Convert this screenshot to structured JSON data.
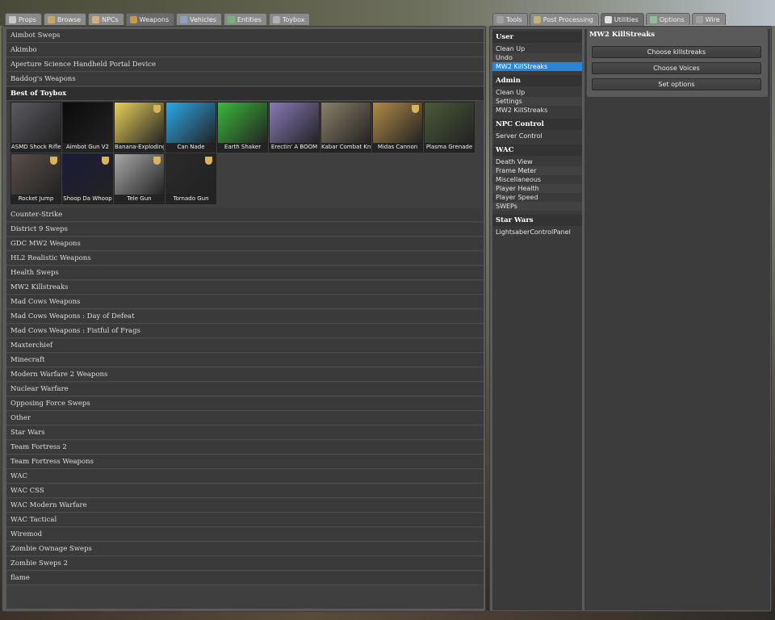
{
  "left_tabs": [
    {
      "label": "Props",
      "icon": "grid-icon",
      "color": "#c8c8c8",
      "active": false
    },
    {
      "label": "Browse",
      "icon": "folder-icon",
      "color": "#c9a75a",
      "active": false
    },
    {
      "label": "NPCs",
      "icon": "npc-icon",
      "color": "#d0b080",
      "active": false
    },
    {
      "label": "Weapons",
      "icon": "bomb-icon",
      "color": "#c89a40",
      "active": true
    },
    {
      "label": "Vehicles",
      "icon": "car-icon",
      "color": "#8aa0c8",
      "active": false
    },
    {
      "label": "Entities",
      "icon": "entity-icon",
      "color": "#7ab07a",
      "active": false
    },
    {
      "label": "Toybox",
      "icon": "toybox-icon",
      "color": "#b0b0b0",
      "active": false
    }
  ],
  "right_tabs": [
    {
      "label": "Tools",
      "icon": "wrench-icon",
      "color": "#a0a0a0",
      "active": false
    },
    {
      "label": "Post Processing",
      "icon": "camera-icon",
      "color": "#c8b070",
      "active": false
    },
    {
      "label": "Utilities",
      "icon": "page-icon",
      "color": "#e0e0e0",
      "active": true
    },
    {
      "label": "Options",
      "icon": "options-icon",
      "color": "#90c090",
      "active": false
    },
    {
      "label": "Wire",
      "icon": "wire-icon",
      "color": "#a0a0a0",
      "active": false
    }
  ],
  "categories_top": [
    "Aimbot Sweps",
    "Akimbo",
    "Aperture Science Handheld Portal Device",
    "Baddog's Weapons"
  ],
  "expanded_category": "Best of Toybox",
  "weapons": [
    {
      "label": "ASMD Shock Rifle",
      "color": "#5a5a62",
      "shield": false
    },
    {
      "label": "Aimbot Gun V2",
      "color": "#0a0a0a",
      "shield": false
    },
    {
      "label": "Banana-Exploding-...",
      "color": "#e8d05a",
      "shield": true
    },
    {
      "label": "Can Nade",
      "color": "#2aa8e8",
      "shield": false
    },
    {
      "label": "Earth Shaker",
      "color": "#3ab83a",
      "shield": false
    },
    {
      "label": "Erectin' A BOOM",
      "color": "#8a7ab8",
      "shield": false
    },
    {
      "label": "Kabar Combat Knife",
      "color": "#8a8068",
      "shield": false
    },
    {
      "label": "Midas Cannon",
      "color": "#b08a48",
      "shield": true
    },
    {
      "label": "Plasma Grenade",
      "color": "#4a5a3a",
      "shield": false
    },
    {
      "label": "Rocket Jump",
      "color": "#5a5048",
      "shield": true
    },
    {
      "label": "Shoop Da Whoop",
      "color": "#1a1a3a",
      "shield": true
    },
    {
      "label": "Tele Gun",
      "color": "#a8a8a8",
      "shield": true
    },
    {
      "label": "Tornado Gun",
      "color": "#2a2a2a",
      "shield": true
    }
  ],
  "categories_bottom": [
    "Counter-Strike",
    "District 9 Sweps",
    "GDC MW2 Weapons",
    "HL2 Realistic Weapons",
    "Health Sweps",
    "MW2 Killstreaks",
    "Mad Cows Weapons",
    "Mad Cows Weapons : Day of Defeat",
    "Mad Cows Weapons : Fistful of Frags",
    "Maxterchief",
    "Minecraft",
    "Modern Warfare 2 Weapons",
    "Nuclear Warfare",
    "Opposing Force Sweps",
    "Other",
    "Star Wars",
    "Team Fortress 2",
    "Team Fortress Weapons",
    "WAC",
    "WAC CSS",
    "WAC Modern Warfare",
    "WAC Tactical",
    "Wiremod",
    "Zombie Ownage Sweps",
    "Zombie Sweps 2",
    "flame"
  ],
  "utility_sections": [
    {
      "title": "User",
      "items": [
        "Clean Up",
        "Undo",
        "MW2 KillStreaks"
      ]
    },
    {
      "title": "Admin",
      "items": [
        "Clean Up",
        "Settings",
        "MW2 KillStreaks"
      ]
    },
    {
      "title": "NPC Control",
      "items": [
        "Server Control"
      ]
    },
    {
      "title": "WAC",
      "items": [
        "Death View",
        "Frame Meter",
        "Miscellaneous",
        "Player Health",
        "Player Speed",
        "SWEPs"
      ]
    },
    {
      "title": "Star Wars",
      "items": [
        "LightsaberControlPanel"
      ]
    }
  ],
  "selected_utility": "MW2 KillStreaks",
  "options_panel": {
    "title": "MW2 KillStreaks",
    "buttons": [
      "Choose killstreaks",
      "Choose Voices",
      "Set options"
    ]
  }
}
